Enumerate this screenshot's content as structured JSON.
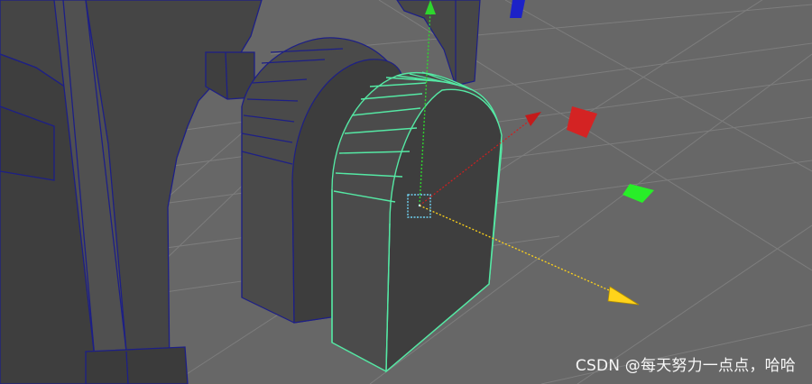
{
  "viewport": {
    "background": "#676767",
    "grid_color": "#7d7d7d",
    "wire_color": "#1d1f86",
    "selected_wire_color": "#55e8a4",
    "object_fill": "#484848"
  },
  "objects": [
    {
      "name": "arch-structure",
      "selected": false
    },
    {
      "name": "arch-block-back",
      "selected": false
    },
    {
      "name": "arch-block-selected",
      "selected": true
    }
  ],
  "manipulator": {
    "icon": "move-manipulator-icon",
    "x_axis_color": "#d11f1f",
    "y_axis_color": "#2ed62e",
    "z_axis_color": "#ffd31a",
    "pivot_color": "#6fd0f0"
  },
  "view_cube_hints": {
    "red_plane": "#d42323",
    "green_plane": "#28ee28",
    "blue_marker": "#1c22c8"
  },
  "watermark": {
    "text": "CSDN @每天努力一点点，哈哈"
  }
}
